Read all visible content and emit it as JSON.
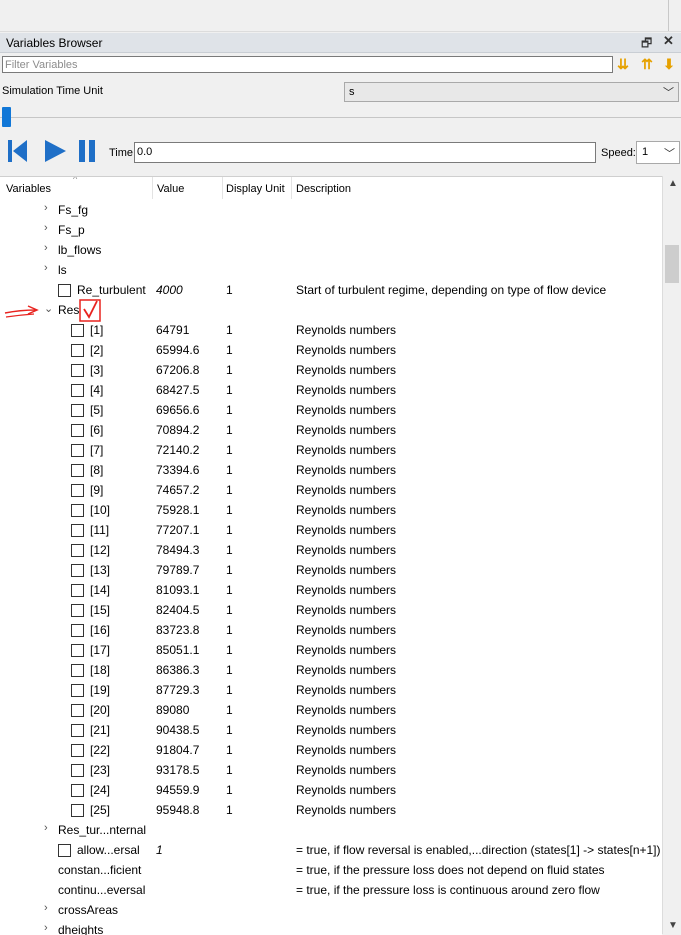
{
  "panel": {
    "title": "Variables Browser",
    "restore_icon": "restore-icon",
    "close_icon": "close-icon"
  },
  "filter": {
    "placeholder": "Filter Variables",
    "value": ""
  },
  "simulation": {
    "time_unit_label": "Simulation Time Unit",
    "time_unit_value": "s"
  },
  "playback": {
    "time_label": "Time:",
    "time_value": "0.0",
    "speed_label": "Speed:",
    "speed_value": "1"
  },
  "columns": {
    "variables": "Variables",
    "value": "Value",
    "display_unit": "Display Unit",
    "description": "Description"
  },
  "rows": [
    {
      "name": "Fs_fg",
      "value": "",
      "unit": "",
      "desc": ""
    },
    {
      "name": "Fs_p",
      "value": "",
      "unit": "",
      "desc": ""
    },
    {
      "name": "lb_flows",
      "value": "",
      "unit": "",
      "desc": ""
    },
    {
      "name": "ls",
      "value": "",
      "unit": "",
      "desc": ""
    },
    {
      "name": "Re_turbulent",
      "value": "4000",
      "unit": "1",
      "desc": "Start of turbulent regime, depending on type of flow device"
    },
    {
      "name": "Res",
      "value": "",
      "unit": "",
      "desc": ""
    },
    {
      "name": "[1]",
      "value": "64791",
      "unit": "1",
      "desc": "Reynolds numbers"
    },
    {
      "name": "[2]",
      "value": "65994.6",
      "unit": "1",
      "desc": "Reynolds numbers"
    },
    {
      "name": "[3]",
      "value": "67206.8",
      "unit": "1",
      "desc": "Reynolds numbers"
    },
    {
      "name": "[4]",
      "value": "68427.5",
      "unit": "1",
      "desc": "Reynolds numbers"
    },
    {
      "name": "[5]",
      "value": "69656.6",
      "unit": "1",
      "desc": "Reynolds numbers"
    },
    {
      "name": "[6]",
      "value": "70894.2",
      "unit": "1",
      "desc": "Reynolds numbers"
    },
    {
      "name": "[7]",
      "value": "72140.2",
      "unit": "1",
      "desc": "Reynolds numbers"
    },
    {
      "name": "[8]",
      "value": "73394.6",
      "unit": "1",
      "desc": "Reynolds numbers"
    },
    {
      "name": "[9]",
      "value": "74657.2",
      "unit": "1",
      "desc": "Reynolds numbers"
    },
    {
      "name": "[10]",
      "value": "75928.1",
      "unit": "1",
      "desc": "Reynolds numbers"
    },
    {
      "name": "[11]",
      "value": "77207.1",
      "unit": "1",
      "desc": "Reynolds numbers"
    },
    {
      "name": "[12]",
      "value": "78494.3",
      "unit": "1",
      "desc": "Reynolds numbers"
    },
    {
      "name": "[13]",
      "value": "79789.7",
      "unit": "1",
      "desc": "Reynolds numbers"
    },
    {
      "name": "[14]",
      "value": "81093.1",
      "unit": "1",
      "desc": "Reynolds numbers"
    },
    {
      "name": "[15]",
      "value": "82404.5",
      "unit": "1",
      "desc": "Reynolds numbers"
    },
    {
      "name": "[16]",
      "value": "83723.8",
      "unit": "1",
      "desc": "Reynolds numbers"
    },
    {
      "name": "[17]",
      "value": "85051.1",
      "unit": "1",
      "desc": "Reynolds numbers"
    },
    {
      "name": "[18]",
      "value": "86386.3",
      "unit": "1",
      "desc": "Reynolds numbers"
    },
    {
      "name": "[19]",
      "value": "87729.3",
      "unit": "1",
      "desc": "Reynolds numbers"
    },
    {
      "name": "[20]",
      "value": "89080",
      "unit": "1",
      "desc": "Reynolds numbers"
    },
    {
      "name": "[21]",
      "value": "90438.5",
      "unit": "1",
      "desc": "Reynolds numbers"
    },
    {
      "name": "[22]",
      "value": "91804.7",
      "unit": "1",
      "desc": "Reynolds numbers"
    },
    {
      "name": "[23]",
      "value": "93178.5",
      "unit": "1",
      "desc": "Reynolds numbers"
    },
    {
      "name": "[24]",
      "value": "94559.9",
      "unit": "1",
      "desc": "Reynolds numbers"
    },
    {
      "name": "[25]",
      "value": "95948.8",
      "unit": "1",
      "desc": "Reynolds numbers"
    },
    {
      "name": "Res_tur...nternal",
      "value": "",
      "unit": "",
      "desc": ""
    },
    {
      "name": "allow...ersal",
      "value": "1",
      "unit": "",
      "desc": "= true, if flow reversal is enabled,...direction (states[1] -> states[n+1])"
    },
    {
      "name": "constan...ficient",
      "value": "",
      "unit": "",
      "desc": "= true, if the pressure loss does not depend on fluid states"
    },
    {
      "name": "continu...eversal",
      "value": "",
      "unit": "",
      "desc": "= true, if the pressure loss is continuous around zero flow"
    },
    {
      "name": "crossAreas",
      "value": "",
      "unit": "",
      "desc": ""
    },
    {
      "name": "dheights",
      "value": "",
      "unit": "",
      "desc": ""
    }
  ],
  "colors": {
    "accent": "#1177d7",
    "annotation": "#e8231f"
  }
}
